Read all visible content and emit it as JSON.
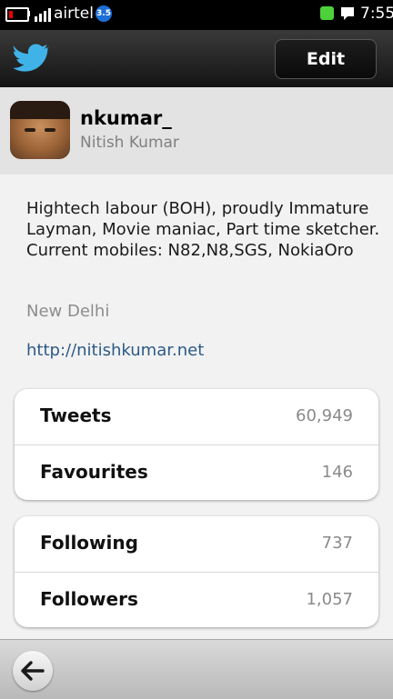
{
  "status_bar": {
    "carrier": "airtel",
    "network_badge": "3.5",
    "time": "7:55",
    "battery_color": "#e00000",
    "notification_color": "#4cd13b"
  },
  "header": {
    "logo_icon": "twitter-bird-icon",
    "edit_label": "Edit",
    "accent": "#3fb3e8"
  },
  "profile": {
    "handle": "nkumar_",
    "name": "Nitish Kumar"
  },
  "bio": {
    "text": "Hightech labour (BOH), proudly Immature Layman, Movie maniac, Part time sketcher. Current mobiles: N82,N8,SGS, NokiaOro",
    "location": "New Delhi",
    "url": "http://nitishkumar.net"
  },
  "stats": {
    "tweets": {
      "label": "Tweets",
      "value": "60,949"
    },
    "favourites": {
      "label": "Favourites",
      "value": "146"
    },
    "following": {
      "label": "Following",
      "value": "737"
    },
    "followers": {
      "label": "Followers",
      "value": "1,057"
    }
  },
  "toolbar": {
    "back_icon": "back-arrow-icon"
  }
}
